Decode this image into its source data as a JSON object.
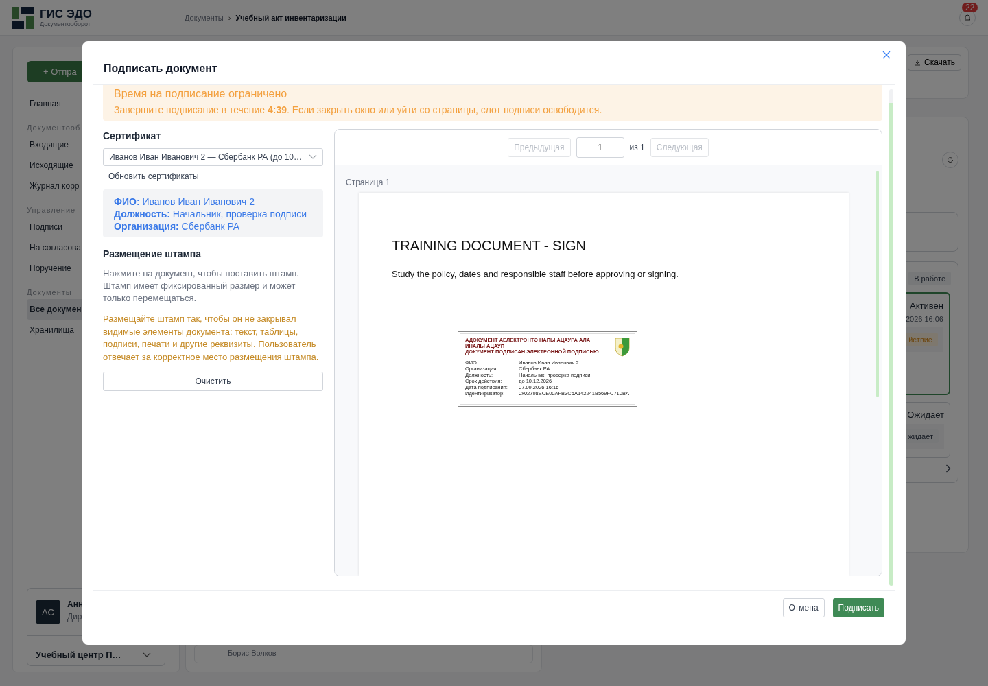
{
  "app": {
    "logo_title": "ГИС ЭДО",
    "logo_subtitle": "Документооборот"
  },
  "breadcrumbs": [
    {
      "label": "Документы",
      "current": false
    },
    {
      "label": "Учебный акт инвентаризации",
      "current": true
    }
  ],
  "breadcrumb_separator": "›",
  "notifications": {
    "count": "22"
  },
  "sidebar": {
    "action_button": {
      "icon": "+",
      "label": "Отпра"
    },
    "items": [
      {
        "kind": "item",
        "label": "Главная",
        "selected": false
      },
      {
        "kind": "section",
        "label": "Документооб"
      },
      {
        "kind": "item",
        "label": "Входящие",
        "selected": false
      },
      {
        "kind": "item",
        "label": "Исходящие",
        "selected": false
      },
      {
        "kind": "item",
        "label": "Журнал корр",
        "selected": false
      },
      {
        "kind": "section",
        "label": "Управление"
      },
      {
        "kind": "item",
        "label": "Подписи",
        "selected": false
      },
      {
        "kind": "item",
        "label": "На согласова",
        "selected": false
      },
      {
        "kind": "item",
        "label": "Поручение",
        "selected": false
      },
      {
        "kind": "section",
        "label": "Документы"
      },
      {
        "kind": "item",
        "label": "Все докумен",
        "selected": true
      },
      {
        "kind": "item",
        "label": "Хранилища",
        "selected": false
      }
    ],
    "user": {
      "initials": "АС",
      "name": "Анн",
      "role": "Дир",
      "organization": "Учебный центр П…"
    }
  },
  "background": {
    "download_button": "Скачать",
    "status_tag": "В работе",
    "cards": [
      {
        "status": "Активен",
        "date": ".2026 16:06",
        "tag": "йствие",
        "kind": "warning",
        "selected": true
      },
      {
        "status": "Ожидает",
        "tag": "жидает",
        "kind": "neutral",
        "selected": false
      }
    ],
    "signer": "Борис Волков"
  },
  "modal": {
    "title": "Подписать документ",
    "warning": {
      "title": "Время на подписание ограничено",
      "text": "Завершите подписание в течение **4:39**. Если закрыть окно или уйти со страницы, слот подписи освободится."
    },
    "certificate": {
      "heading": "Сертификат",
      "value": "Иванов Иван Иванович 2 — Сбербанк РА (до 10…",
      "refresh_link": "Обновить сертификаты"
    },
    "signer_info": [
      {
        "label": "ФИО:",
        "value": "Иванов Иван Иванович 2"
      },
      {
        "label": "Должность:",
        "value": "Начальник, проверка подписи"
      },
      {
        "label": "Организация:",
        "value": "Сбербанк РА"
      }
    ],
    "stamp_placement": {
      "heading": "Размещение штампа",
      "hint": "Нажмите на документ, чтобы поставить штамп. Штамп имеет фиксированный размер и может только перемещаться.",
      "warning": "Размещайте штамп так, чтобы он не закрывал видимые элементы документа: текст, таблицы, подписи, печати и другие реквизиты. Пользователь отвечает за корректное место размещения штампа."
    },
    "clear_button": "Очистить",
    "viewer": {
      "prev_button": {
        "label": "Предыдущая",
        "disabled": true
      },
      "page_input": "1",
      "page_total": "из 1",
      "next_button": {
        "label": "Следующая",
        "disabled": true
      },
      "page_label": "Страница 1",
      "document": {
        "title": "TRAINING DOCUMENT - SIGN",
        "text": "Study the policy, dates and responsible staff before approving or signing."
      },
      "stamp": {
        "header": [
          "АДОКУМЕНТ АЕЛЕКТРОНТӘ НАПЫ АЦАУРА АЛА ИНАЛЫ АЦАУП",
          "ДОКУМЕНТ ПОДПИСАН ЭЛЕКТРОННОЙ ПОДПИСЬЮ"
        ],
        "fields": [
          {
            "label": "ФИО:",
            "value": "Иванов Иван Иванович 2"
          },
          {
            "label": "Организация:",
            "value": "Сбербанк РА"
          },
          {
            "label": "Должность:",
            "value": "Начальник, проверка подписи"
          },
          {
            "label": "Срок действия:",
            "value": "до 10.12.2026"
          },
          {
            "label": "Дата подписания:",
            "value": "07.09.2026 16:16"
          },
          {
            "label": "Идентификатор:",
            "value": "0x02798BCE00AFB3C5A142241B569FC710BA"
          }
        ]
      }
    },
    "cancel_button": "Отмена",
    "sign_button": "Подписать"
  }
}
